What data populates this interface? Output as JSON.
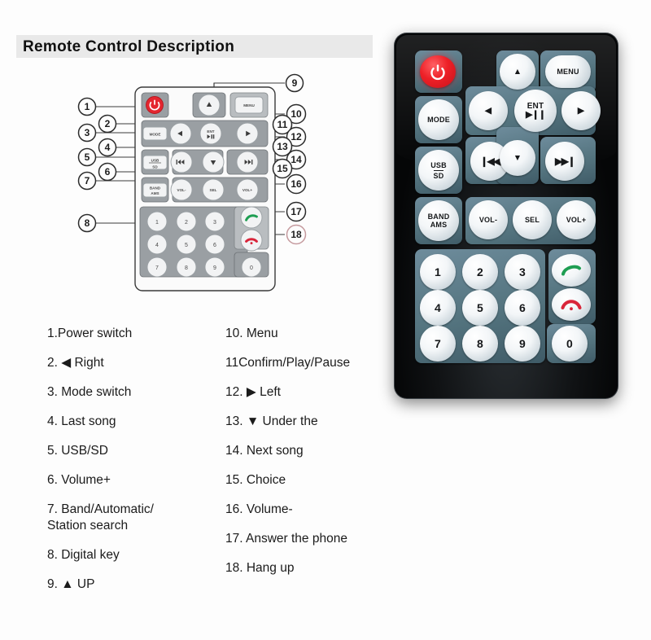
{
  "header": {
    "title": "Remote Control Description"
  },
  "legend": {
    "left": [
      "1.Power switch",
      "2. ◀ Right",
      "3. Mode switch",
      "4. Last song",
      "5. USB/SD",
      "6. Volume+",
      "7. Band/Automatic/\nStation search",
      "8. Digital key",
      "9. ▲ UP"
    ],
    "right": [
      "10. Menu",
      "11Confirm/Play/Pause",
      "12. ▶  Left",
      "13. ▼  Under the",
      "14. Next song",
      "15. Choice",
      "16. Volume-",
      "17. Answer the phone",
      "18. Hang up"
    ]
  },
  "callouts": {
    "left": [
      "1",
      "2",
      "3",
      "4",
      "5",
      "6",
      "7",
      "8"
    ],
    "right": [
      "9",
      "10",
      "11",
      "12",
      "13",
      "14",
      "15",
      "16",
      "17",
      "18"
    ]
  },
  "remote": {
    "buttons": {
      "power": "power-icon",
      "up": "▲",
      "menu": "MENU",
      "mode": "MODE",
      "left": "◀",
      "ent_line1": "ENT",
      "ent_line2": "▶❙❙",
      "right": "▶",
      "usb": "USB",
      "sd": "SD",
      "prev": "❙◀◀",
      "down": "▼",
      "next": "▶▶❙",
      "band": "BAND",
      "ams": "AMS",
      "vol_down": "VOL-",
      "sel": "SEL",
      "vol_up": "VOL+",
      "answer": "answer-call-icon",
      "hangup": "hang-up-icon"
    },
    "keypad": [
      "1",
      "2",
      "3",
      "4",
      "5",
      "6",
      "7",
      "8",
      "9",
      "0"
    ]
  },
  "colors": {
    "panel": "#54747f",
    "body": "#0b0d0e",
    "power_red": "#ed2027",
    "answer_green": "#1e9e52",
    "hangup_red": "#d9253a",
    "header_band": "#e9e9e9"
  }
}
